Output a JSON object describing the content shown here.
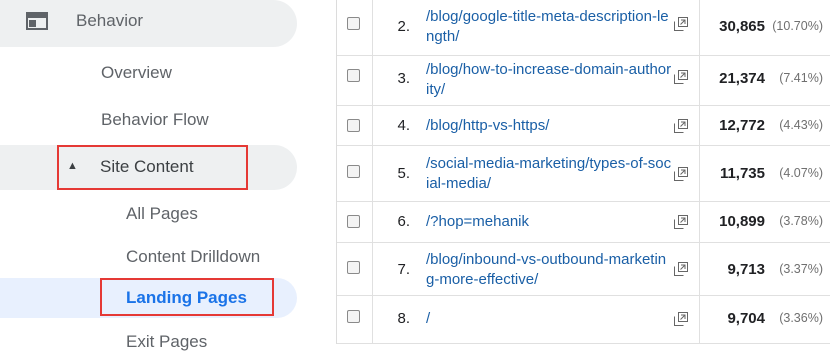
{
  "sidebar": {
    "behavior_label": "Behavior",
    "overview_label": "Overview",
    "behavior_flow_label": "Behavior Flow",
    "site_content_label": "Site Content",
    "all_pages_label": "All Pages",
    "content_drilldown_label": "Content Drilldown",
    "landing_pages_label": "Landing Pages",
    "exit_pages_label": "Exit Pages"
  },
  "table": {
    "rows": [
      {
        "index": "2.",
        "url": "/blog/google-title-meta-description-length/",
        "value": "30,865",
        "percent": "(10.70%)"
      },
      {
        "index": "3.",
        "url": "/blog/how-to-increase-domain-authority/",
        "value": "21,374",
        "percent": "(7.41%)"
      },
      {
        "index": "4.",
        "url": "/blog/http-vs-https/",
        "value": "12,772",
        "percent": "(4.43%)"
      },
      {
        "index": "5.",
        "url": "/social-media-marketing/types-of-social-media/",
        "value": "11,735",
        "percent": "(4.07%)"
      },
      {
        "index": "6.",
        "url": "/?hop=mehanik",
        "value": "10,899",
        "percent": "(3.78%)"
      },
      {
        "index": "7.",
        "url": "/blog/inbound-vs-outbound-marketing-more-effective/",
        "value": "9,713",
        "percent": "(3.37%)"
      },
      {
        "index": "8.",
        "url": "/",
        "value": "9,704",
        "percent": "(3.36%)"
      }
    ]
  },
  "colors": {
    "link": "#1a5fa6",
    "highlight_box": "#e53935",
    "active_nav": "#1a73e8"
  }
}
